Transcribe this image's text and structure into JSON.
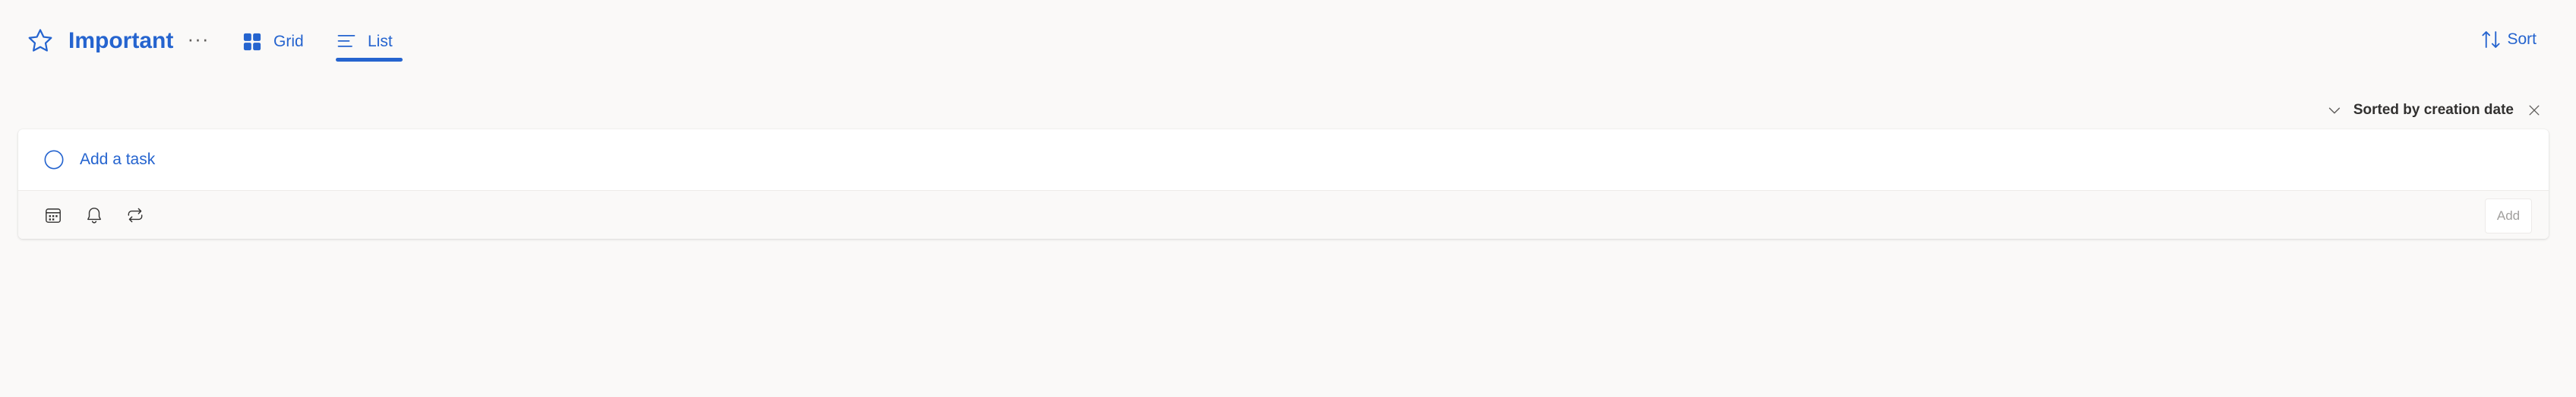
{
  "header": {
    "title": "Important",
    "more_label": "···",
    "tabs": [
      {
        "label": "Grid",
        "icon": "grid-icon"
      },
      {
        "label": "List",
        "icon": "list-icon",
        "selected": true
      }
    ],
    "sort_label": "Sort"
  },
  "sort_indicator": {
    "text": "Sorted by creation date"
  },
  "add_task": {
    "placeholder": "Add a task",
    "toolbar_icons": [
      "calendar-icon",
      "bell-icon",
      "repeat-icon"
    ],
    "add_button_label": "Add"
  },
  "colors": {
    "accent": "#2564cf",
    "background": "#faf9f8",
    "card": "#ffffff",
    "muted_text": "#a19f9d"
  }
}
